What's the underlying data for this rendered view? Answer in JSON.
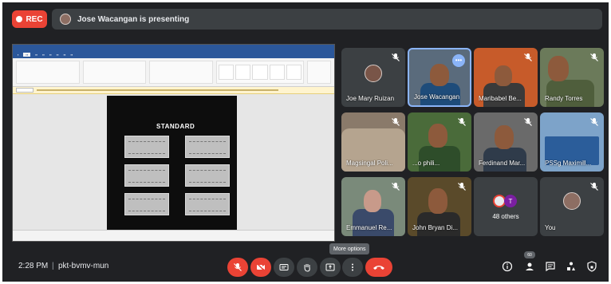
{
  "recording": {
    "label": "REC"
  },
  "presenter": {
    "banner": "Jose Wacangan is presenting"
  },
  "shared_screen": {
    "document_heading": "STANDARD"
  },
  "participants": [
    {
      "name": "Joe Mary Ruizan",
      "muted": true
    },
    {
      "name": "Jose Wacangan",
      "muted": false,
      "speaking": true
    },
    {
      "name": "Maribabel Be...",
      "muted": true
    },
    {
      "name": "Randy Torres",
      "muted": true
    },
    {
      "name": "Magsingal Poli...",
      "muted": true
    },
    {
      "name": "...o phili...",
      "muted": true
    },
    {
      "name": "Ferdinand Mar...",
      "muted": true
    },
    {
      "name": "PSSg Maximill...",
      "muted": true
    },
    {
      "name": "Emmanuel Re...",
      "muted": true
    },
    {
      "name": "John Bryan Di...",
      "muted": true
    },
    {
      "name": "48 others"
    },
    {
      "name": "You",
      "muted": true
    }
  ],
  "others_avatar_letter": "T",
  "footer": {
    "time": "2:28 PM",
    "separator": "|",
    "meeting_code": "pkt-bvmv-mun",
    "tooltip": "More options",
    "people_badge": "60"
  },
  "colors": {
    "background": "#202124",
    "tile": "#3c4043",
    "danger": "#ea4335",
    "accent": "#8ab4f8"
  }
}
